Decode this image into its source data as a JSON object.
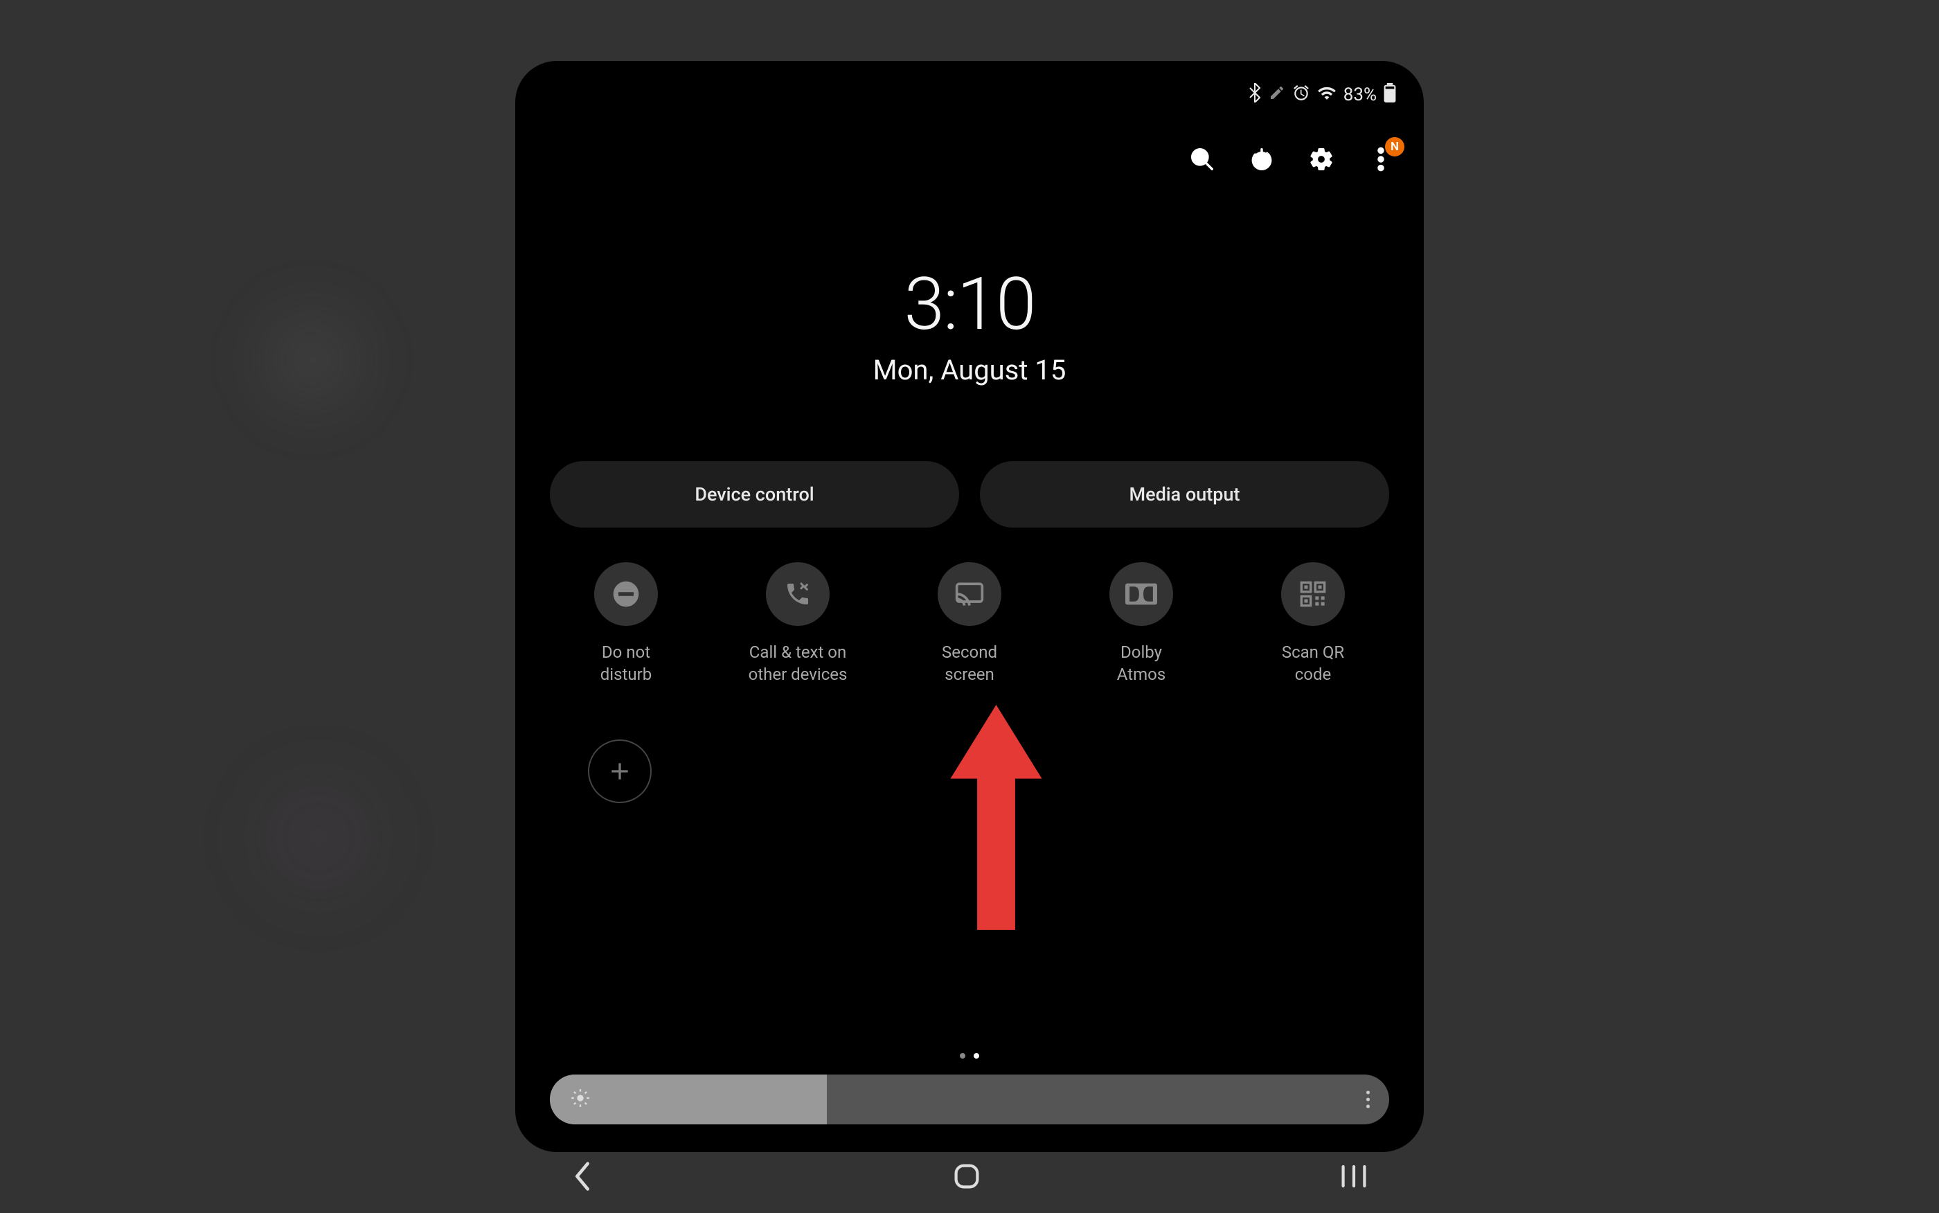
{
  "status": {
    "battery_percent": "83%",
    "notification_badge": "N"
  },
  "clock": {
    "time": "3:10",
    "date": "Mon, August 15"
  },
  "pills": {
    "device_control": "Device control",
    "media_output": "Media output"
  },
  "tiles": {
    "dnd": "Do not\ndisturb",
    "call_text": "Call & text on\nother devices",
    "second_screen": "Second\nscreen",
    "dolby": "Dolby\nAtmos",
    "qr": "Scan QR\ncode"
  },
  "colors": {
    "accent": "#ef6c00",
    "annotation": "#e53935"
  },
  "pagination": {
    "current": 1,
    "total": 2
  },
  "brightness": {
    "level_percent": 33
  }
}
